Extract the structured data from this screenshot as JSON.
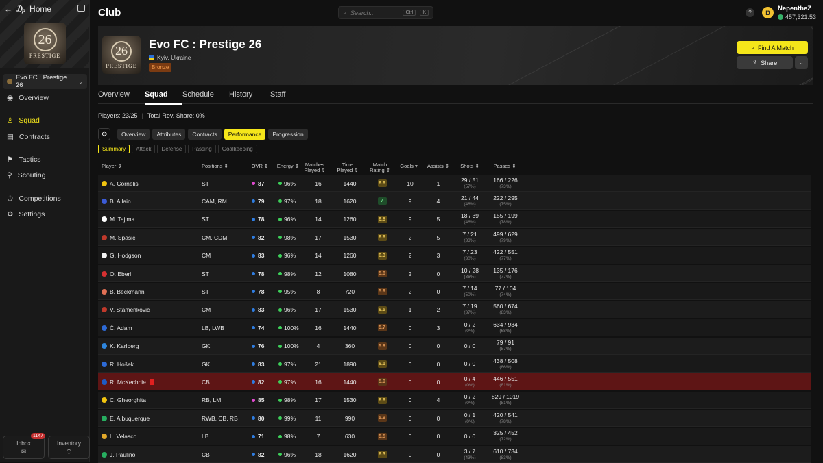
{
  "sidebar": {
    "home_label": "Home",
    "club_selector": "Evo FC : Prestige 26",
    "logo_number": "26",
    "logo_word": "PRESTIGE",
    "nav": [
      {
        "label": "Overview",
        "icon": "eye-icon"
      },
      {
        "label": "Squad",
        "icon": "shirt-icon",
        "active": true
      },
      {
        "label": "Contracts",
        "icon": "document-icon"
      },
      {
        "label": "Tactics",
        "icon": "tactics-icon"
      },
      {
        "label": "Scouting",
        "icon": "person-search-icon"
      },
      {
        "label": "Competitions",
        "icon": "trophy-icon"
      },
      {
        "label": "Settings",
        "icon": "gear-icon"
      }
    ],
    "inbox_label": "Inbox",
    "inbox_badge": "1147",
    "inventory_label": "Inventory"
  },
  "topbar": {
    "title": "Club",
    "search_placeholder": "Search...",
    "search_kbd1": "Ctrl",
    "search_kbd2": "K",
    "help": "?",
    "username": "NepentheZ",
    "balance": "457,321.53"
  },
  "club": {
    "name": "Evo FC : Prestige 26",
    "location": "Kyiv, Ukraine",
    "tier": "Bronze",
    "find_match": "Find A Match",
    "share": "Share"
  },
  "tabs": [
    "Overview",
    "Squad",
    "Schedule",
    "History",
    "Staff"
  ],
  "meta": {
    "players": "Players: 23/25",
    "rev_share": "Total Rev. Share: 0%"
  },
  "views": [
    "Overview",
    "Attributes",
    "Contracts",
    "Performance",
    "Progression"
  ],
  "subviews": [
    "Summary",
    "Attack",
    "Defense",
    "Passing",
    "Goalkeeping"
  ],
  "columns": {
    "player": "Player ⇕",
    "positions": "Positions ⇕",
    "ovr": "OVR ⇕",
    "energy": "Energy ⇕",
    "matches1": "Matches",
    "matches2": "Played ⇕",
    "time1": "Time",
    "time2": "Played ⇕",
    "rating1": "Match",
    "rating2": "Rating ⇕",
    "goals": "Goals ▾",
    "assists": "Assists ⇕",
    "shots": "Shots ⇕",
    "passes": "Passes ⇕"
  },
  "colors": {
    "accent": "#f5e61a",
    "ovr_pink": "#e04ad0",
    "ovr_blue": "#2f7de1",
    "energy_green": "#3dd05a",
    "highlight_row": "#5e1515"
  },
  "players": [
    {
      "name": "A. Cornelis",
      "flag": "#f1c40f",
      "pos": "ST",
      "ovr": "87",
      "ovr_color": "#e04ad0",
      "energy": "96%",
      "mp": "16",
      "tp": "1440",
      "rating": "6.6",
      "r_bg": "#5c4b16",
      "r_fg": "#e8c65a",
      "goals": "10",
      "assists": "1",
      "shots": "29 / 51",
      "shots_pct": "(57%)",
      "passes": "166 / 226",
      "passes_pct": "(73%)"
    },
    {
      "name": "B. Allain",
      "flag": "#3b5bd6",
      "pos": "CAM, RM",
      "ovr": "79",
      "ovr_color": "#2f7de1",
      "energy": "97%",
      "mp": "18",
      "tp": "1620",
      "rating": "7",
      "r_bg": "#1f4d2a",
      "r_fg": "#6fdc8a",
      "goals": "9",
      "assists": "4",
      "shots": "21 / 44",
      "shots_pct": "(48%)",
      "passes": "222 / 295",
      "passes_pct": "(75%)"
    },
    {
      "name": "M. Tajima",
      "flag": "#ffffff",
      "pos": "ST",
      "ovr": "78",
      "ovr_color": "#2f7de1",
      "energy": "96%",
      "mp": "14",
      "tp": "1260",
      "rating": "6.8",
      "r_bg": "#5c4b16",
      "r_fg": "#e8c65a",
      "goals": "9",
      "assists": "5",
      "shots": "18 / 39",
      "shots_pct": "(46%)",
      "passes": "155 / 199",
      "passes_pct": "(78%)"
    },
    {
      "name": "M. Spasić",
      "flag": "#c0392b",
      "pos": "CM, CDM",
      "ovr": "82",
      "ovr_color": "#2f7de1",
      "energy": "98%",
      "mp": "17",
      "tp": "1530",
      "rating": "6.6",
      "r_bg": "#5c4b16",
      "r_fg": "#e8c65a",
      "goals": "2",
      "assists": "5",
      "shots": "7 / 21",
      "shots_pct": "(33%)",
      "passes": "499 / 629",
      "passes_pct": "(79%)"
    },
    {
      "name": "G. Hodgson",
      "flag": "#f5f5f5",
      "pos": "CM",
      "ovr": "83",
      "ovr_color": "#2f7de1",
      "energy": "96%",
      "mp": "14",
      "tp": "1260",
      "rating": "6.3",
      "r_bg": "#5c4b16",
      "r_fg": "#e8c65a",
      "goals": "2",
      "assists": "3",
      "shots": "7 / 23",
      "shots_pct": "(30%)",
      "passes": "422 / 551",
      "passes_pct": "(77%)"
    },
    {
      "name": "O. Eberl",
      "flag": "#d63031",
      "pos": "ST",
      "ovr": "78",
      "ovr_color": "#2f7de1",
      "energy": "98%",
      "mp": "12",
      "tp": "1080",
      "rating": "5.8",
      "r_bg": "#5a3618",
      "r_fg": "#e09a5a",
      "goals": "2",
      "assists": "0",
      "shots": "10 / 28",
      "shots_pct": "(36%)",
      "passes": "135 / 176",
      "passes_pct": "(77%)"
    },
    {
      "name": "B. Beckmann",
      "flag": "#e17055",
      "pos": "ST",
      "ovr": "78",
      "ovr_color": "#2f7de1",
      "energy": "95%",
      "mp": "8",
      "tp": "720",
      "rating": "5.9",
      "r_bg": "#5a3618",
      "r_fg": "#e09a5a",
      "goals": "2",
      "assists": "0",
      "shots": "7 / 14",
      "shots_pct": "(50%)",
      "passes": "77 / 104",
      "passes_pct": "(74%)"
    },
    {
      "name": "V. Stamenković",
      "flag": "#c0392b",
      "pos": "CM",
      "ovr": "83",
      "ovr_color": "#2f7de1",
      "energy": "96%",
      "mp": "17",
      "tp": "1530",
      "rating": "6.5",
      "r_bg": "#5c4b16",
      "r_fg": "#e8c65a",
      "goals": "1",
      "assists": "2",
      "shots": "7 / 19",
      "shots_pct": "(37%)",
      "passes": "560 / 674",
      "passes_pct": "(83%)"
    },
    {
      "name": "Č. Adam",
      "flag": "#2d6ad6",
      "pos": "LB, LWB",
      "ovr": "74",
      "ovr_color": "#2f7de1",
      "energy": "100%",
      "mp": "16",
      "tp": "1440",
      "rating": "5.7",
      "r_bg": "#5a3618",
      "r_fg": "#e09a5a",
      "goals": "0",
      "assists": "3",
      "shots": "0 / 2",
      "shots_pct": "(0%)",
      "passes": "634 / 934",
      "passes_pct": "(68%)"
    },
    {
      "name": "K. Karlberg",
      "flag": "#2e86de",
      "pos": "GK",
      "ovr": "76",
      "ovr_color": "#2f7de1",
      "energy": "100%",
      "mp": "4",
      "tp": "360",
      "rating": "5.8",
      "r_bg": "#5a3618",
      "r_fg": "#e09a5a",
      "goals": "0",
      "assists": "0",
      "shots": "0 / 0",
      "shots_pct": "",
      "passes": "79 / 91",
      "passes_pct": "(87%)"
    },
    {
      "name": "R. Hošek",
      "flag": "#2d6ad6",
      "pos": "GK",
      "ovr": "83",
      "ovr_color": "#2f7de1",
      "energy": "97%",
      "mp": "21",
      "tp": "1890",
      "rating": "6.1",
      "r_bg": "#5c4b16",
      "r_fg": "#e8c65a",
      "goals": "0",
      "assists": "0",
      "shots": "0 / 0",
      "shots_pct": "",
      "passes": "438 / 508",
      "passes_pct": "(86%)"
    },
    {
      "name": "R. McKechnie",
      "flag": "#1e5bc6",
      "pos": "CB",
      "ovr": "82",
      "ovr_color": "#2f7de1",
      "energy": "97%",
      "mp": "16",
      "tp": "1440",
      "rating": "5.9",
      "r_bg": "#5a3618",
      "r_fg": "#e09a5a",
      "goals": "0",
      "assists": "0",
      "shots": "0 / 4",
      "shots_pct": "(0%)",
      "passes": "446 / 551",
      "passes_pct": "(81%)",
      "highlight": true
    },
    {
      "name": "C. Gheorghita",
      "flag": "#f1c40f",
      "pos": "RB, LM",
      "ovr": "85",
      "ovr_color": "#e04ad0",
      "energy": "98%",
      "mp": "17",
      "tp": "1530",
      "rating": "6.6",
      "r_bg": "#5c4b16",
      "r_fg": "#e8c65a",
      "goals": "0",
      "assists": "4",
      "shots": "0 / 2",
      "shots_pct": "(0%)",
      "passes": "829 / 1019",
      "passes_pct": "(81%)"
    },
    {
      "name": "E. Albuquerque",
      "flag": "#27ae60",
      "pos": "RWB, CB, RB",
      "ovr": "80",
      "ovr_color": "#2f7de1",
      "energy": "99%",
      "mp": "11",
      "tp": "990",
      "rating": "5.9",
      "r_bg": "#5a3618",
      "r_fg": "#e09a5a",
      "goals": "0",
      "assists": "0",
      "shots": "0 / 1",
      "shots_pct": "(0%)",
      "passes": "420 / 541",
      "passes_pct": "(78%)"
    },
    {
      "name": "L. Velasco",
      "flag": "#e1a82a",
      "pos": "LB",
      "ovr": "71",
      "ovr_color": "#2f7de1",
      "energy": "98%",
      "mp": "7",
      "tp": "630",
      "rating": "5.5",
      "r_bg": "#5a3618",
      "r_fg": "#e09a5a",
      "goals": "0",
      "assists": "0",
      "shots": "0 / 0",
      "shots_pct": "",
      "passes": "325 / 452",
      "passes_pct": "(72%)"
    },
    {
      "name": "J. Paulino",
      "flag": "#27ae60",
      "pos": "CB",
      "ovr": "82",
      "ovr_color": "#2f7de1",
      "energy": "96%",
      "mp": "18",
      "tp": "1620",
      "rating": "6.3",
      "r_bg": "#5c4b16",
      "r_fg": "#e8c65a",
      "goals": "0",
      "assists": "0",
      "shots": "3 / 7",
      "shots_pct": "(43%)",
      "passes": "610 / 734",
      "passes_pct": "(83%)"
    }
  ]
}
